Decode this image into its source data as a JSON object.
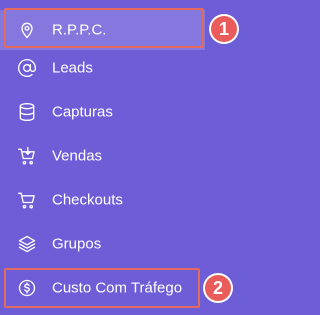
{
  "colors": {
    "sidebar_bg": "#6d5ed8",
    "highlight_border": "#e46a60",
    "badge_bg": "#ea5b5b",
    "text": "#ffffff"
  },
  "menu": {
    "items": [
      {
        "label": "R.P.P.C.",
        "icon": "location-pin-icon"
      },
      {
        "label": "Leads",
        "icon": "at-sign-icon"
      },
      {
        "label": "Capturas",
        "icon": "database-icon"
      },
      {
        "label": "Vendas",
        "icon": "shopping-cart-download-icon"
      },
      {
        "label": "Checkouts",
        "icon": "shopping-cart-icon"
      },
      {
        "label": "Grupos",
        "icon": "layers-icon"
      },
      {
        "label": "Custo Com Tráfego",
        "icon": "dollar-circle-icon"
      }
    ]
  },
  "annotations": {
    "badge_1": "1",
    "badge_2": "2"
  }
}
